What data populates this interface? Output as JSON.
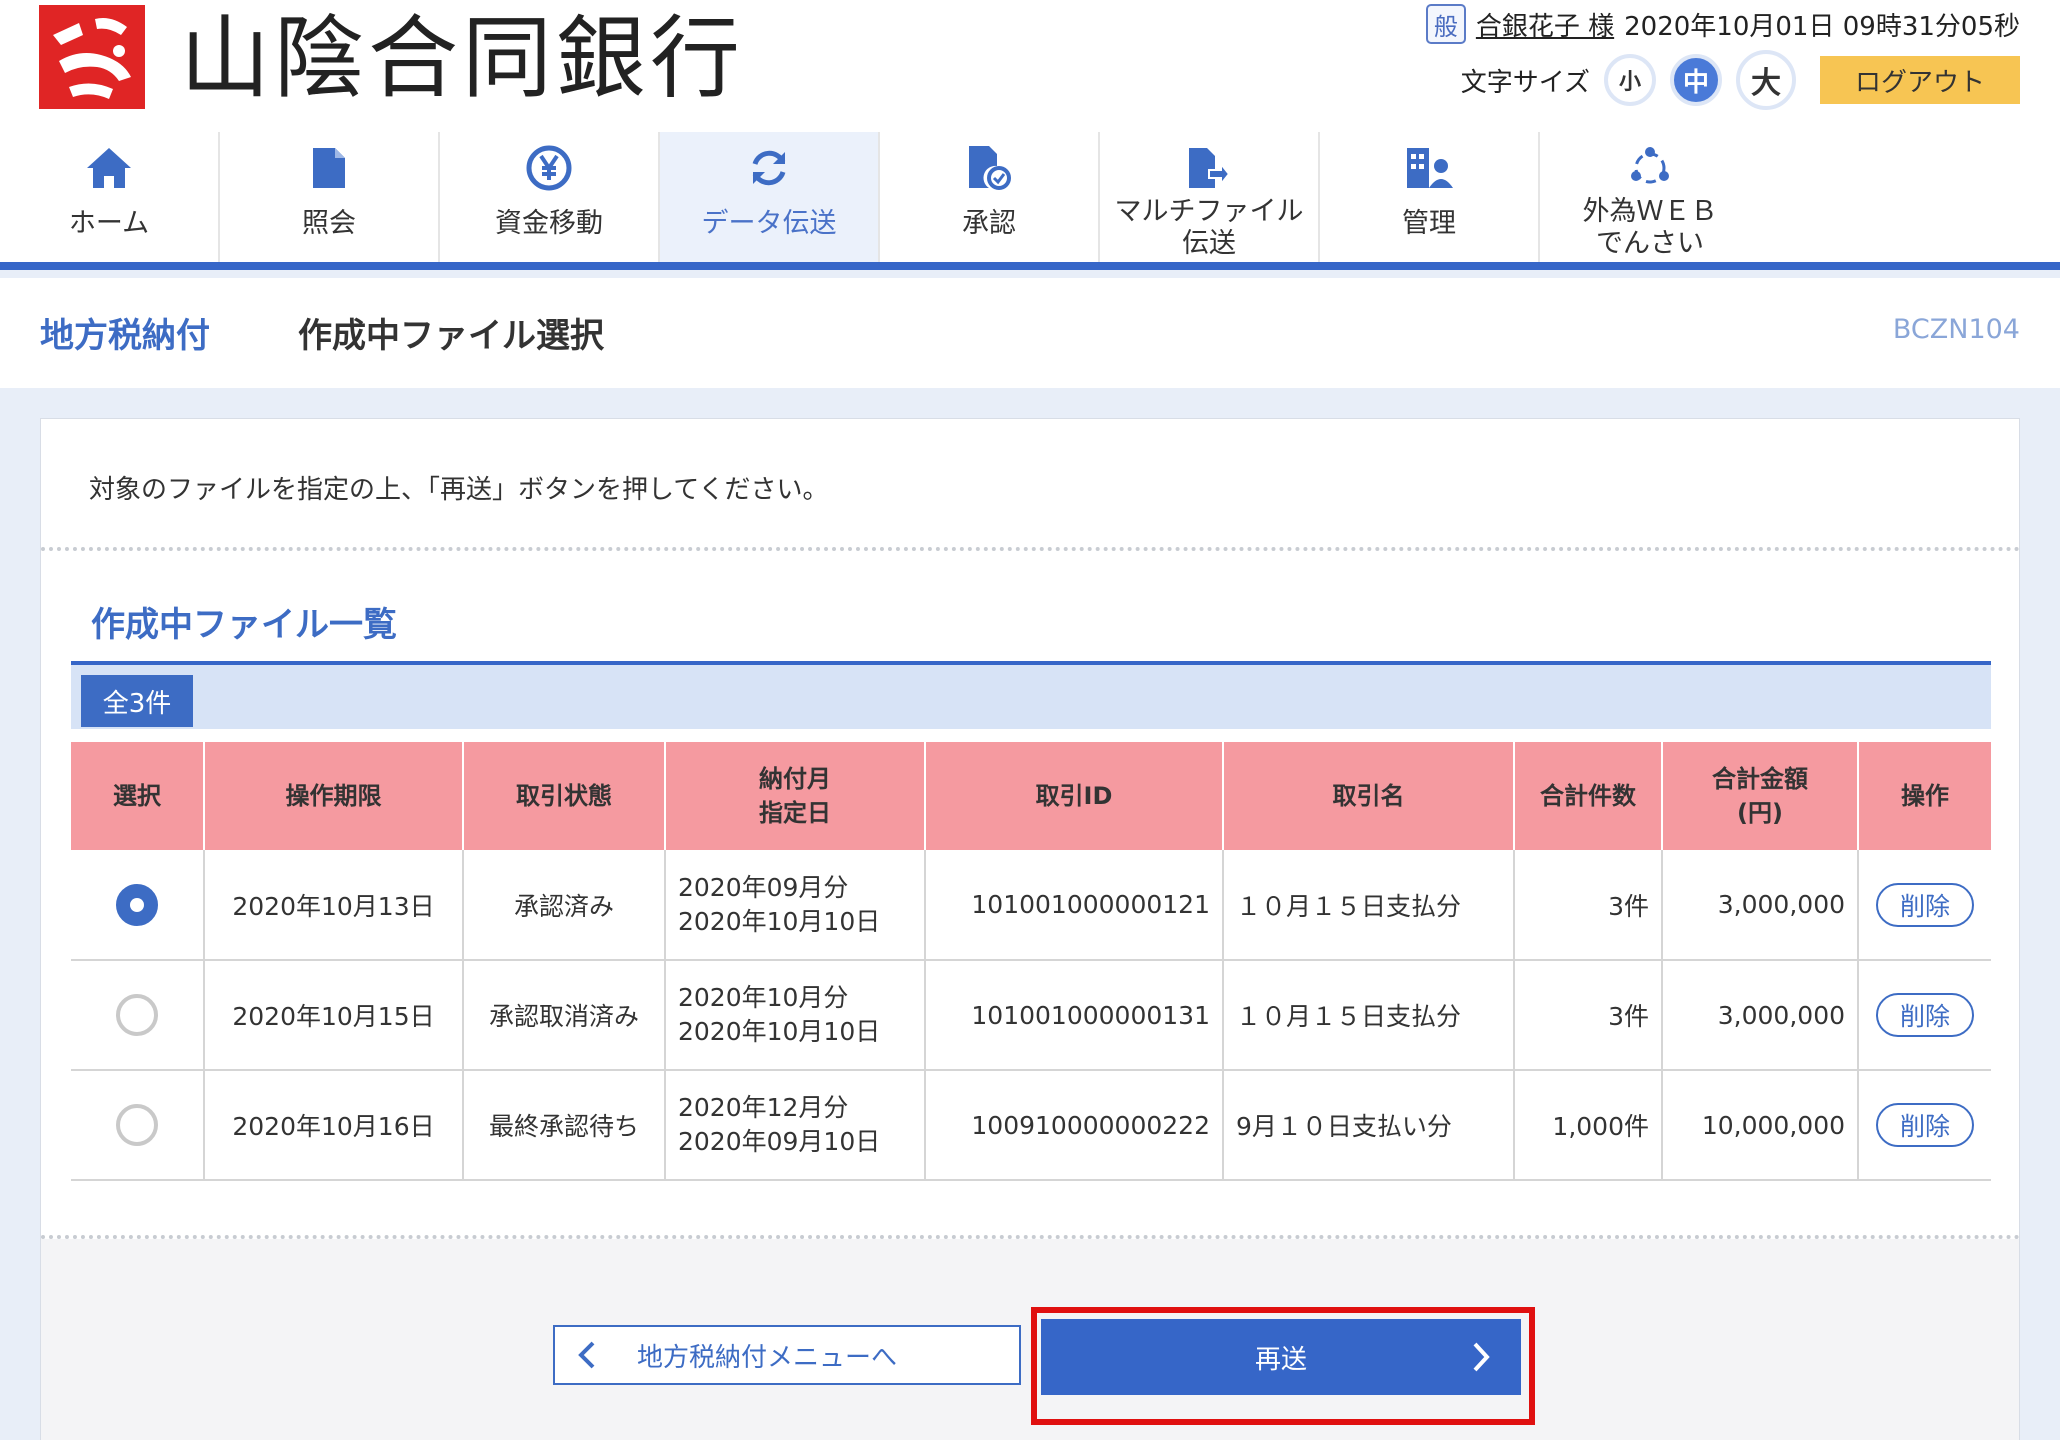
{
  "header": {
    "bank_name": "山陰合同銀行",
    "user_badge": "般",
    "user_name": "合銀花子 様",
    "datetime": "2020年10月01日 09時31分05秒",
    "font_size_label": "文字サイズ",
    "font_small": "小",
    "font_medium": "中",
    "font_large": "大",
    "logout": "ログアウト"
  },
  "nav": [
    {
      "label": "ホーム",
      "icon": "home-icon"
    },
    {
      "label": "照会",
      "icon": "document-icon"
    },
    {
      "label": "資金移動",
      "icon": "yen-transfer-icon"
    },
    {
      "label": "データ伝送",
      "icon": "refresh-icon",
      "active": true
    },
    {
      "label": "承認",
      "icon": "approve-document-icon"
    },
    {
      "label_line1": "マルチファイル",
      "label_line2": "伝送",
      "icon": "file-send-icon"
    },
    {
      "label": "管理",
      "icon": "admin-icon"
    },
    {
      "label_line1": "外為ＷＥＢ",
      "label_line2": "でんさい",
      "icon": "network-icon"
    }
  ],
  "titlebar": {
    "breadcrumb": "地方税納付",
    "title": "作成中ファイル選択",
    "screen_id": "BCZN104"
  },
  "instruction": "対象のファイルを指定の上、「再送」ボタンを押してください。",
  "section": {
    "title": "作成中ファイル一覧",
    "count": "全3件"
  },
  "table": {
    "headers": {
      "select": "選択",
      "deadline": "操作期限",
      "status": "取引状態",
      "pay_month_1": "納付月",
      "pay_month_2": "指定日",
      "txn_id": "取引ID",
      "txn_name": "取引名",
      "total_count": "合計件数",
      "total_amount_1": "合計金額",
      "total_amount_2": "(円)",
      "action": "操作"
    },
    "rows": [
      {
        "selected": true,
        "deadline": "2020年10月13日",
        "status": "承認済み",
        "pay_month": "2020年09月分",
        "designated_date": "2020年10月10日",
        "txn_id": "101001000000121",
        "txn_name": "１０月１５日支払分",
        "total_count": "3件",
        "total_amount": "3,000,000",
        "action": "削除"
      },
      {
        "selected": false,
        "deadline": "2020年10月15日",
        "status": "承認取消済み",
        "pay_month": "2020年10月分",
        "designated_date": "2020年10月10日",
        "txn_id": "101001000000131",
        "txn_name": "１０月１５日支払分",
        "total_count": "3件",
        "total_amount": "3,000,000",
        "action": "削除"
      },
      {
        "selected": false,
        "deadline": "2020年10月16日",
        "status": "最終承認待ち",
        "pay_month": "2020年12月分",
        "designated_date": "2020年09月10日",
        "txn_id": "100910000000222",
        "txn_name": "9月１０日支払い分",
        "total_count": "1,000件",
        "total_amount": "10,000,000",
        "action": "削除"
      }
    ]
  },
  "buttons": {
    "back": "地方税納付メニューへ",
    "resend": "再送"
  },
  "colors": {
    "primary": "#3666c8",
    "header_row": "#f59aa0",
    "logout": "#f7c553",
    "highlight": "#e01010",
    "logo": "#e02525"
  }
}
